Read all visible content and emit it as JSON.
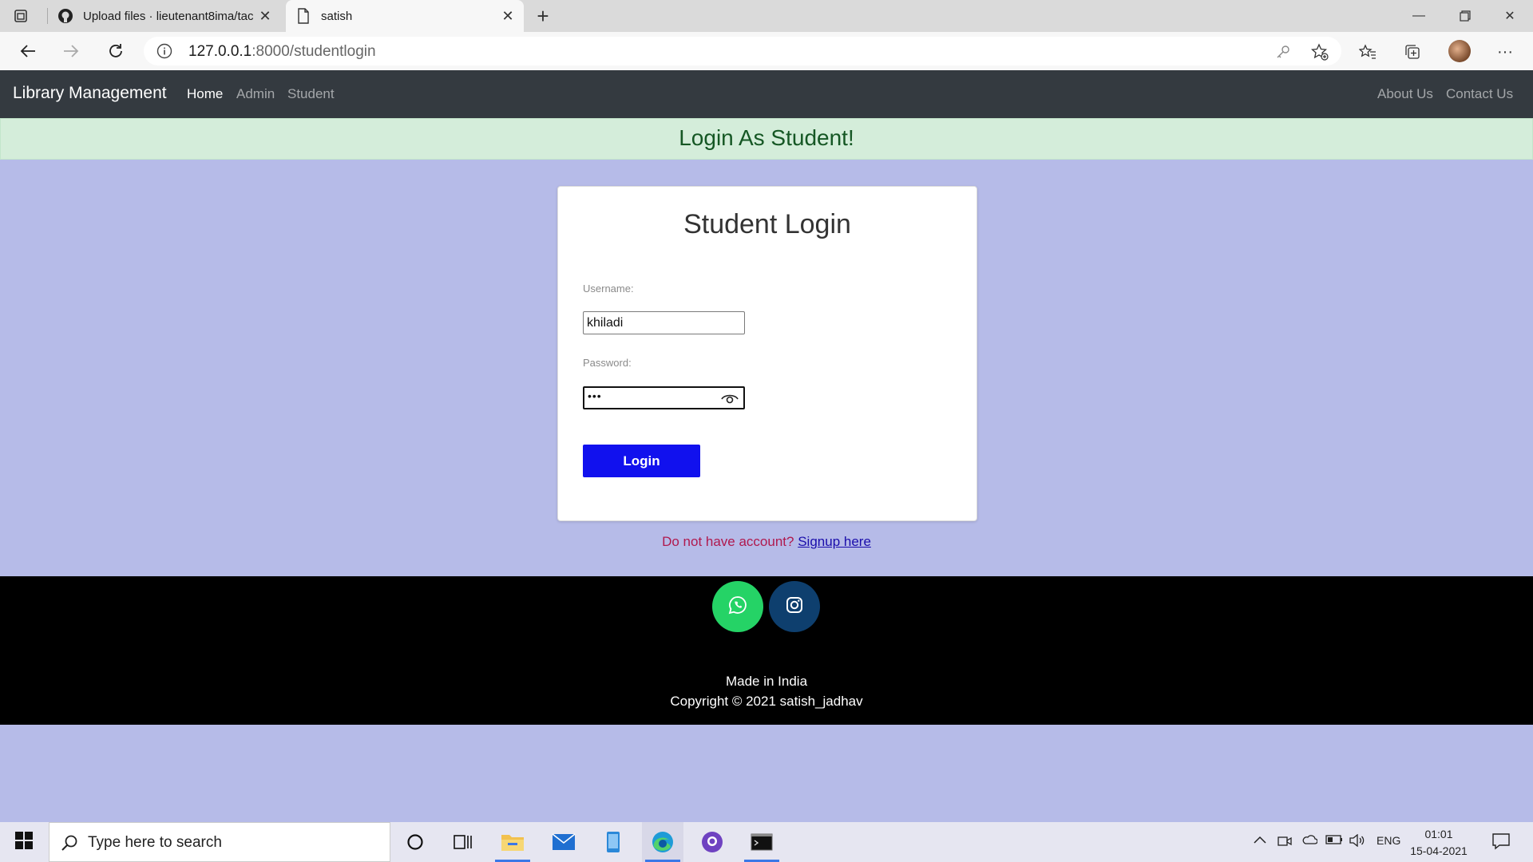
{
  "browser": {
    "tabs": [
      {
        "title": "Upload files · lieutenant8ima/tac",
        "active": false
      },
      {
        "title": "satish",
        "active": true
      }
    ],
    "url_host": "127.0.0.1",
    "url_path": ":8000/studentlogin"
  },
  "navbar": {
    "brand": "Library Management",
    "left_links": [
      "Home",
      "Admin",
      "Student"
    ],
    "right_links": [
      "About Us",
      "Contact Us"
    ]
  },
  "alert": {
    "text": "Login As Student!"
  },
  "login": {
    "title": "Student Login",
    "username_label": "Username:",
    "username_value": "khiladi",
    "password_label": "Password:",
    "password_value": "•••",
    "button": "Login"
  },
  "signup": {
    "text": "Do not have account?",
    "link": "Signup here"
  },
  "footer": {
    "made_in": "Made in India",
    "copyright": "Copyright © 2021 satish_jadhav",
    "social": [
      "whatsapp-icon",
      "instagram-icon"
    ]
  },
  "taskbar": {
    "search_placeholder": "Type here to search",
    "language": "ENG",
    "time": "01:01",
    "date": "15-04-2021"
  },
  "colors": {
    "page_bg": "#b6bbe8",
    "navbar_bg": "#343a40",
    "alert_bg": "#d4edda",
    "alert_text": "#155724",
    "button_bg": "#1111ee",
    "signup_text": "#b0194e",
    "whatsapp": "#25d366",
    "instagram": "#0e3f6e"
  }
}
